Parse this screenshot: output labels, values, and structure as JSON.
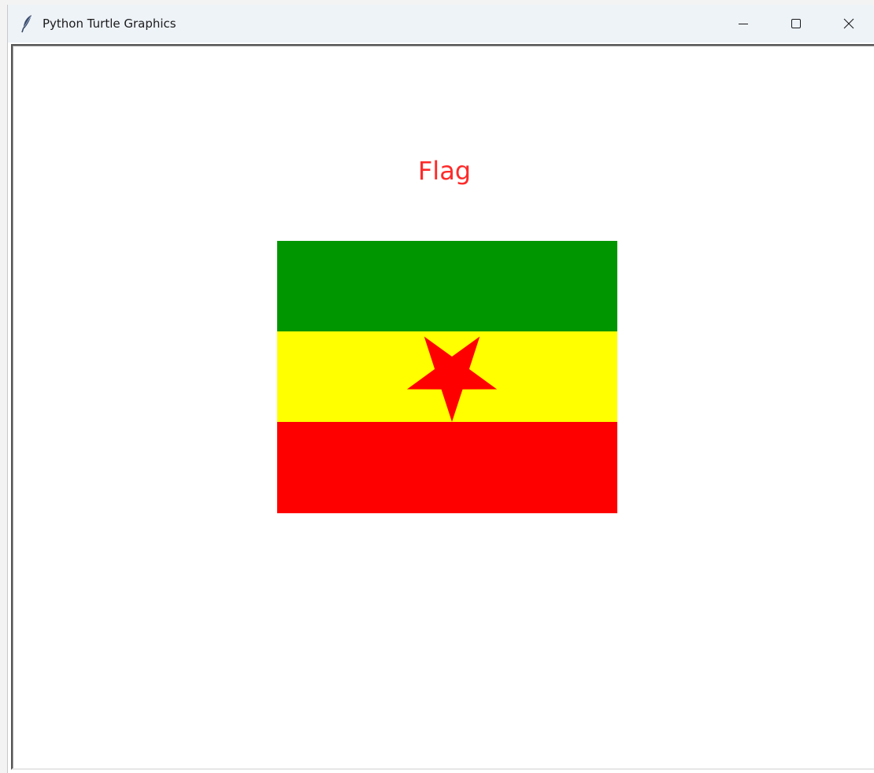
{
  "window": {
    "title": "Python Turtle Graphics",
    "icon": "feather-icon",
    "controls": {
      "minimize": "minimize-icon",
      "maximize": "maximize-icon",
      "close": "close-icon"
    }
  },
  "canvas": {
    "title_text": "Flag",
    "title_color": "#ff2a2a",
    "flag": {
      "stripe_colors": [
        "#009600",
        "#ffff00",
        "#ff0000"
      ],
      "star_color": "#ff0000",
      "star_icon": "star-icon"
    }
  }
}
